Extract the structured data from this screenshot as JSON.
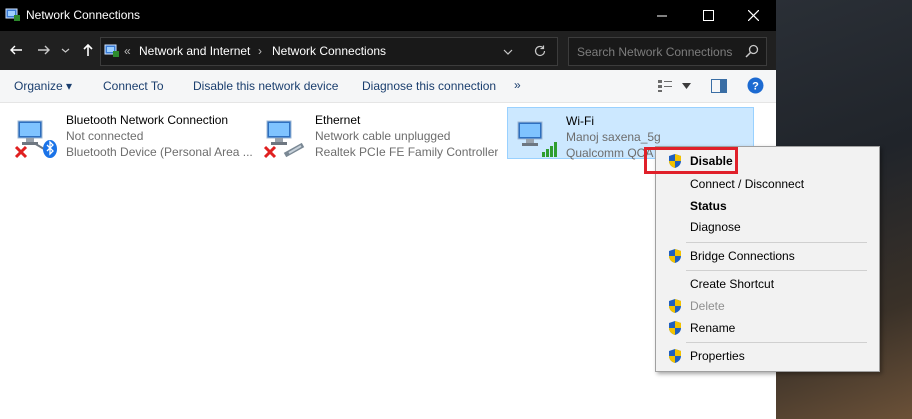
{
  "window": {
    "title": "Network Connections"
  },
  "address": {
    "overflow": "«",
    "crumbs": [
      "Network and Internet",
      "Network Connections"
    ]
  },
  "search": {
    "placeholder": "Search Network Connections"
  },
  "commands": {
    "organize": "Organize ▾",
    "connect_to": "Connect To",
    "disable_device": "Disable this network device",
    "diagnose": "Diagnose this connection",
    "more": "»"
  },
  "connections": [
    {
      "name": "Bluetooth Network Connection",
      "status": "Not connected",
      "device": "Bluetooth Device (Personal Area ..."
    },
    {
      "name": "Ethernet",
      "status": "Network cable unplugged",
      "device": "Realtek PCIe FE Family Controller"
    },
    {
      "name": "Wi-Fi",
      "status": "Manoj saxena_5g",
      "device": "Qualcomm QCA"
    }
  ],
  "context_menu": {
    "disable": "Disable",
    "connect_disconnect": "Connect / Disconnect",
    "status": "Status",
    "diagnose": "Diagnose",
    "bridge": "Bridge Connections",
    "create_shortcut": "Create Shortcut",
    "delete": "Delete",
    "rename": "Rename",
    "properties": "Properties"
  },
  "colors": {
    "highlight_box": "#e0202a",
    "selected_bg": "#cce8ff",
    "link_text": "#1a3e6e"
  }
}
